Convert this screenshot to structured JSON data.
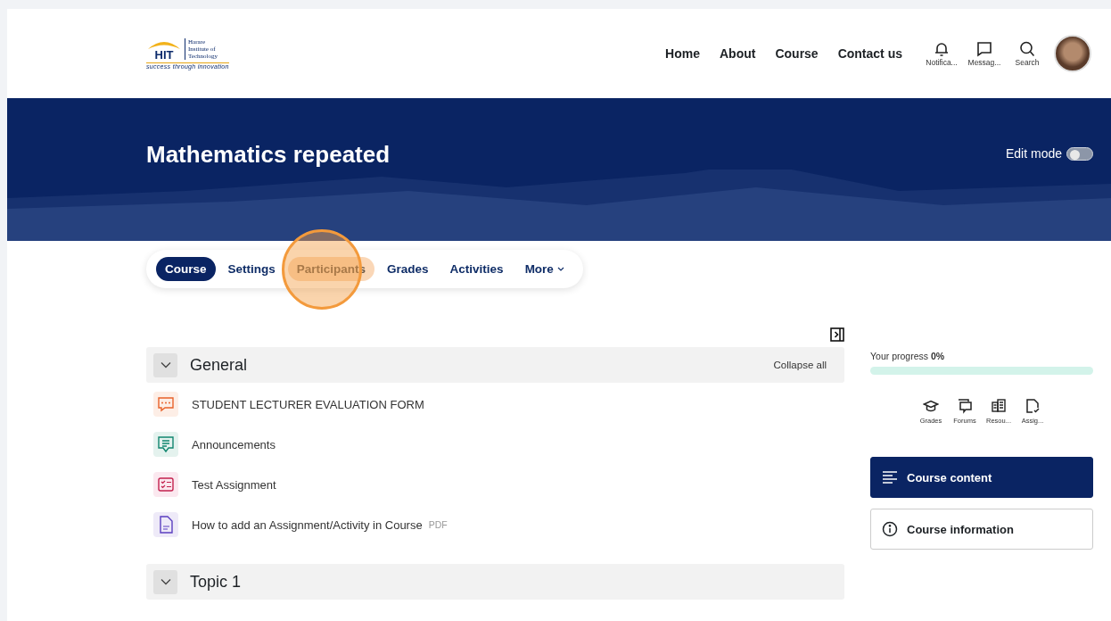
{
  "logo": {
    "mark": "HIT",
    "name_lines": [
      "Harare",
      "Institute of",
      "Technology"
    ],
    "tagline": "success through innovation"
  },
  "nav": [
    "Home",
    "About",
    "Course",
    "Contact us"
  ],
  "nav_icons": [
    {
      "kind": "bell",
      "label": "Notifica..."
    },
    {
      "kind": "chat",
      "label": "Messag..."
    },
    {
      "kind": "search",
      "label": "Search"
    }
  ],
  "banner": {
    "title": "Mathematics repeated",
    "edit_mode": {
      "label": "Edit mode",
      "on": false
    }
  },
  "tabs": [
    {
      "label": "Course",
      "selected": true,
      "highlighted": false
    },
    {
      "label": "Settings",
      "selected": false,
      "highlighted": false
    },
    {
      "label": "Participants",
      "selected": false,
      "highlighted": true
    },
    {
      "label": "Grades",
      "selected": false,
      "highlighted": false
    },
    {
      "label": "Activities",
      "selected": false,
      "highlighted": false
    },
    {
      "label": "More",
      "selected": false,
      "highlighted": false,
      "dropdown": true
    }
  ],
  "sections": [
    {
      "title": "General",
      "expanded": true,
      "action": "Collapse all",
      "items": [
        {
          "kind": "feedback",
          "name": "STUDENT LECTURER EVALUATION FORM"
        },
        {
          "kind": "forum",
          "name": "Announcements"
        },
        {
          "kind": "assign",
          "name": "Test Assignment"
        },
        {
          "kind": "resource",
          "name": "How to add an Assignment/Activity in Course",
          "tag": "PDF"
        }
      ]
    },
    {
      "title": "Topic 1",
      "expanded": true
    }
  ],
  "progress": {
    "label": "Your progress",
    "value": "0%",
    "level": 0
  },
  "activity_links": [
    {
      "kind": "grades",
      "label": "Grades"
    },
    {
      "kind": "forums",
      "label": "Forums"
    },
    {
      "kind": "resources",
      "label": "Resou..."
    },
    {
      "kind": "assignments",
      "label": "Assig..."
    }
  ],
  "side_nav": [
    {
      "kind": "content",
      "label": "Course content",
      "selected": true
    },
    {
      "kind": "info",
      "label": "Course information",
      "selected": false
    }
  ]
}
